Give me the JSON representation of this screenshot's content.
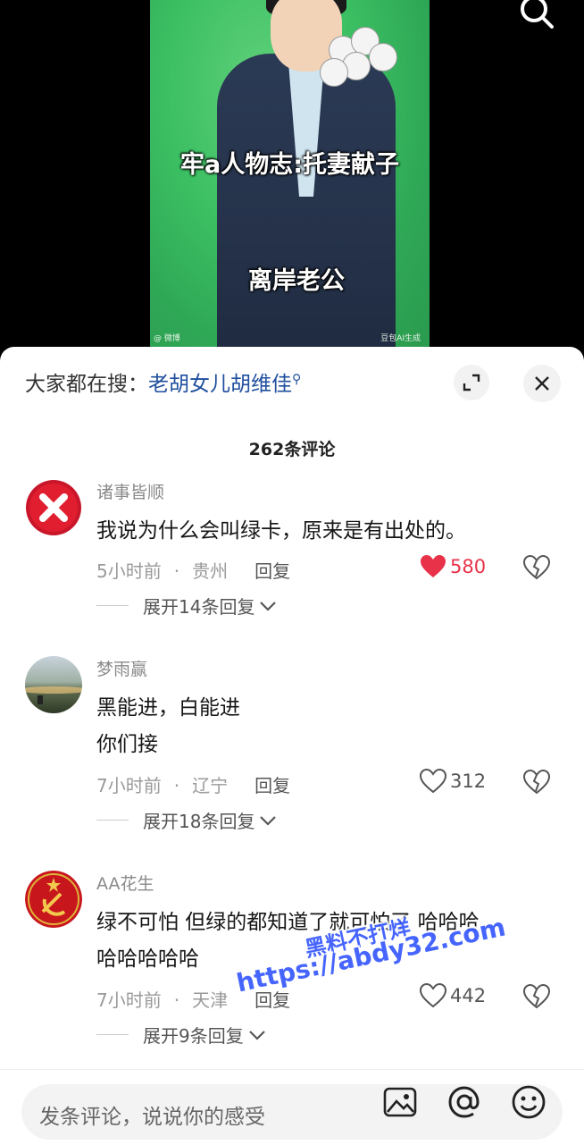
{
  "video": {
    "caption_top": "牢a人物志:托妻献子",
    "caption_bottom": "离岸老公",
    "watermark_right": "豆包AI生成",
    "watermark_left": "@ 微博"
  },
  "comments_sheet": {
    "suggest_prefix": "大家都在搜：",
    "suggest_keyword": "老胡女儿胡维佳",
    "comment_count": "262条评论",
    "comments": [
      {
        "user": "诸事皆顺",
        "text_lines": [
          "我说为什么会叫绿卡，原来是有出处的。"
        ],
        "time": "5小时前",
        "location": "贵州",
        "reply_label": "回复",
        "likes": "580",
        "liked": true,
        "expand_label": "展开14条回复"
      },
      {
        "user": "梦雨赢",
        "text_lines": [
          "黑能进，白能进",
          "你们接"
        ],
        "time": "7小时前",
        "location": "辽宁",
        "reply_label": "回复",
        "likes": "312",
        "liked": false,
        "expand_label": "展开18条回复"
      },
      {
        "user": "AA花生",
        "text_lines": [
          "绿不可怕 但绿的都知道了就可怕了 哈哈哈",
          "哈哈哈哈哈"
        ],
        "time": "7小时前",
        "location": "天津",
        "reply_label": "回复",
        "likes": "442",
        "liked": false,
        "expand_label": "展开9条回复"
      }
    ]
  },
  "overlay_watermark": {
    "line1": "黑料不打烊",
    "line2": "https://abdy32.com"
  },
  "input_bar": {
    "placeholder": "发条评论，说说你的感受"
  },
  "colors": {
    "like_red": "#e8324a",
    "link_blue": "#1f4f9e",
    "video_green": "#3cbf63"
  },
  "icons": [
    "search-icon",
    "expand-icon",
    "close-icon",
    "heart-icon",
    "broken-heart-icon",
    "chevron-down-icon",
    "image-icon",
    "at-icon",
    "emoji-icon"
  ]
}
